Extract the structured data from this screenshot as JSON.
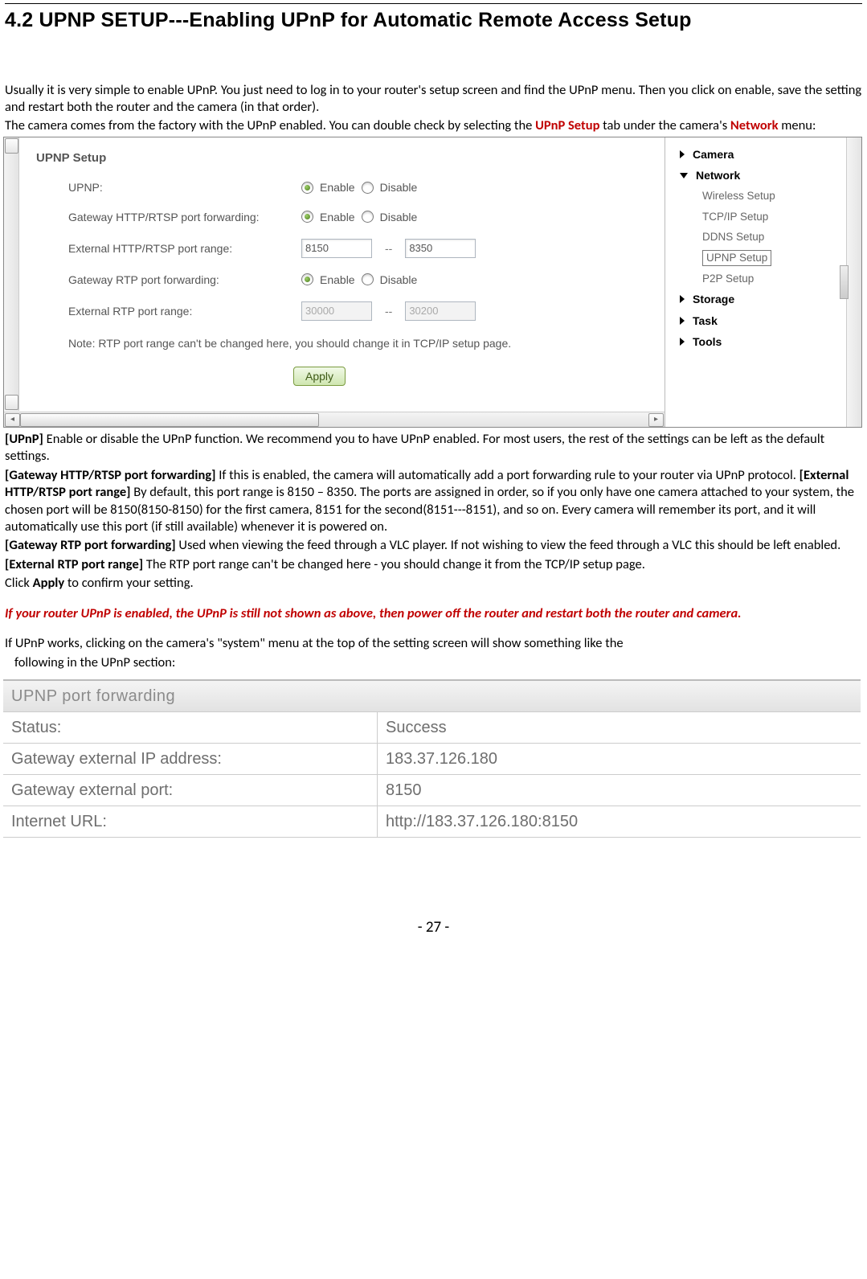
{
  "section_title": "4.2 UPNP SETUP---Enabling UPnP for Automatic Remote Access Setup",
  "intro": {
    "p1": "Usually it is very simple to enable UPnP. You just need to log in to your router's setup screen and find the UPnP menu. Then you click on enable, save the setting and restart both the router and the camera (in that order).",
    "p2a": "The camera comes from the factory with the UPnP enabled. You can double check by selecting the ",
    "p2_tab": "UPnP Setup",
    "p2b": " tab under the camera's ",
    "p2_menu": "Network",
    "p2c": " menu:"
  },
  "upnp_panel": {
    "title": "UPNP Setup",
    "rows": {
      "upnp_label": "UPNP:",
      "gw_http_label": "Gateway HTTP/RTSP port forwarding:",
      "ext_http_label": "External HTTP/RTSP port range:",
      "ext_http_from": "8150",
      "ext_http_to": "8350",
      "gw_rtp_label": "Gateway RTP port forwarding:",
      "ext_rtp_label": "External RTP port range:",
      "ext_rtp_from": "30000",
      "ext_rtp_to": "30200",
      "enable_label": "Enable",
      "disable_label": "Disable",
      "range_sep": "--"
    },
    "note": "Note: RTP port range can't be changed here, you should change it in TCP/IP setup page.",
    "apply": "Apply"
  },
  "nav": {
    "camera": "Camera",
    "network": "Network",
    "wireless": "Wireless Setup",
    "tcpip": "TCP/IP Setup",
    "ddns": "DDNS Setup",
    "upnp": "UPNP Setup",
    "p2p": "P2P Setup",
    "storage": "Storage",
    "task": "Task",
    "tools": "Tools"
  },
  "body": {
    "p_upnp_b": "[UPnP]",
    "p_upnp": " Enable or disable the UPnP function. We recommend you to have UPnP enabled. For most users, the rest of the settings can be left as the default settings.",
    "p_gwhttp_b": "[Gateway HTTP/RTSP port forwarding]",
    "p_gwhttp": " If this is enabled, the camera will automatically add a port forwarding rule to your router via UPnP protocol. ",
    "p_exthttp_b": "[External HTTP/RTSP port range]",
    "p_exthttp": " By default, this port range is 8150 – 8350. The ports are assigned in order, so if you only have one camera attached to your system, the chosen port will be 8150(8150-8150) for the first camera, 8151 for the second(8151---8151), and so on. Every camera will remember its port, and it will automatically use this port (if still available) whenever it is powered on.",
    "p_gwrtp_b": "[Gateway RTP port forwarding]",
    "p_gwrtp": " Used when viewing the feed through a VLC player. If not wishing to view the feed through a VLC this should be left enabled.",
    "p_extrtp_b": "[External RTP port range]",
    "p_extrtp": " The RTP port range can't be changed here - you should change it from the TCP/IP setup page.",
    "p_apply_a": "Click ",
    "p_apply_b": "Apply",
    "p_apply_c": " to confirm your setting.",
    "p_warn": "If your router UPnP is enabled, the UPnP is still not shown as above, then power off the router and restart both the router and camera.",
    "p_works1": "If UPnP works, clicking on the camera's \"system\" menu at the top of the setting screen will show something like the",
    "p_works2": "following in the UPnP section:"
  },
  "status_table": {
    "header": "UPNP port forwarding",
    "rows": [
      {
        "label": "Status:",
        "value": "Success"
      },
      {
        "label": "Gateway external IP address:",
        "value": "183.37.126.180"
      },
      {
        "label": "Gateway external port:",
        "value": "8150"
      },
      {
        "label": "Internet URL:",
        "value": "http://183.37.126.180:8150"
      }
    ]
  },
  "page_number": "- 27 -"
}
